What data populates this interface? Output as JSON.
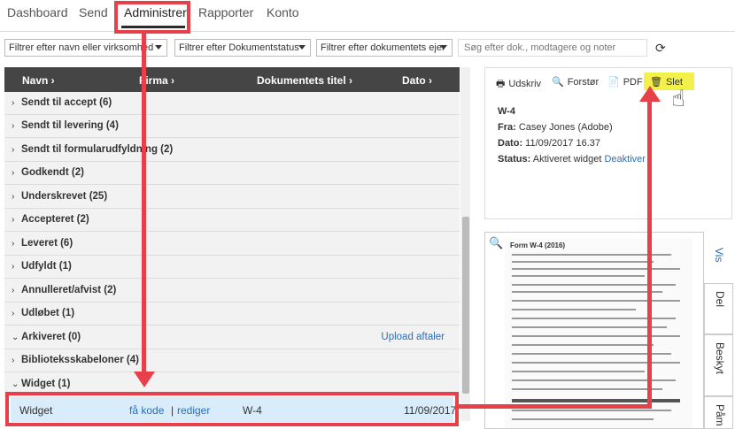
{
  "nav": {
    "tabs": [
      "Dashboard",
      "Send",
      "Administrer",
      "Rapporter",
      "Konto"
    ],
    "active": "Administrer"
  },
  "filters": {
    "sender": "Filtrer efter navn eller virksomhed",
    "status": "Filtrer efter Dokumentstatus",
    "owner": "Filtrer efter dokumentets ejer",
    "search_placeholder": "Søg efter dok., modtagere og noter"
  },
  "table": {
    "headers": [
      "Navn",
      "Firma",
      "Dokumentets titel",
      "Dato"
    ],
    "groups": [
      {
        "label": "Sendt til accept (6)",
        "expanded": false
      },
      {
        "label": "Sendt til levering (4)",
        "expanded": false
      },
      {
        "label": "Sendt til formularudfyldning (2)",
        "expanded": false
      },
      {
        "label": "Godkendt (2)",
        "expanded": false
      },
      {
        "label": "Underskrevet (25)",
        "expanded": false
      },
      {
        "label": "Accepteret (2)",
        "expanded": false
      },
      {
        "label": "Leveret (6)",
        "expanded": false
      },
      {
        "label": "Udfyldt (1)",
        "expanded": false
      },
      {
        "label": "Annulleret/afvist (2)",
        "expanded": false
      },
      {
        "label": "Udløbet (1)",
        "expanded": false
      },
      {
        "label": "Arkiveret (0)",
        "expanded": true,
        "action": "Upload aftaler"
      },
      {
        "label": "Biblioteksskabeloner (4)",
        "expanded": false
      },
      {
        "label": "Widget (1)",
        "expanded": true
      }
    ],
    "selected_row": {
      "name": "Widget",
      "link1": "få kode",
      "sep": "|",
      "link2": "rediger",
      "title": "W-4",
      "date": "11/09/2017"
    }
  },
  "details": {
    "toolbar": {
      "print": "Udskriv",
      "zoom": "Forstør",
      "pdf": "PDF",
      "delete": "Slet"
    },
    "doc_title": "W-4",
    "from_label": "Fra:",
    "from_value": "Casey Jones (Adobe)",
    "date_label": "Dato:",
    "date_value": "11/09/2017 16.37",
    "status_label": "Status:",
    "status_value": "Aktiveret widget",
    "status_link": "Deaktiver"
  },
  "preview": {
    "form_title": "Form W-4 (2016)",
    "side_tabs": [
      "Vis",
      "Del",
      "Beskyt",
      "Påm"
    ]
  },
  "colors": {
    "annotation": "#e8404a",
    "link": "#2a6ebb",
    "header_bg": "#454545",
    "highlight": "#f3f04a",
    "selected_bg": "#d9ecfa"
  }
}
